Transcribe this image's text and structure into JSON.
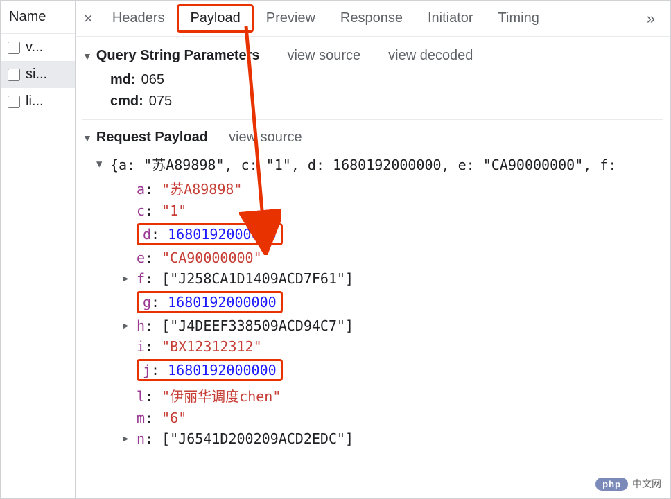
{
  "left": {
    "header": "Name",
    "items": [
      {
        "label": "v...",
        "selected": false
      },
      {
        "label": "si...",
        "selected": true
      },
      {
        "label": "li...",
        "selected": false
      }
    ]
  },
  "tabs": {
    "close_glyph": "×",
    "items": [
      "Headers",
      "Payload",
      "Preview",
      "Response",
      "Initiator",
      "Timing"
    ],
    "highlighted_index": 1,
    "more_glyph": "»"
  },
  "query_section": {
    "title": "Query String Parameters",
    "view_source": "view source",
    "view_decoded": "view decoded",
    "params": [
      {
        "key": "md:",
        "value": "065"
      },
      {
        "key": "cmd:",
        "value": "075"
      }
    ]
  },
  "payload_section": {
    "title": "Request Payload",
    "view_source": "view source",
    "preview_line": "{a: \"苏A89898\", c: \"1\", d: 1680192000000, e: \"CA90000000\", f:",
    "properties": [
      {
        "key": "a",
        "value": "\"苏A89898\"",
        "type": "str",
        "arrow": false,
        "boxed": false
      },
      {
        "key": "c",
        "value": "\"1\"",
        "type": "str",
        "arrow": false,
        "boxed": false
      },
      {
        "key": "d",
        "value": "1680192000000",
        "type": "num",
        "arrow": false,
        "boxed": true
      },
      {
        "key": "e",
        "value": "\"CA90000000\"",
        "type": "str",
        "arrow": false,
        "boxed": false
      },
      {
        "key": "f",
        "value": "[\"J258CA1D1409ACD7F61\"]",
        "type": "punct",
        "arrow": true,
        "boxed": false
      },
      {
        "key": "g",
        "value": "1680192000000",
        "type": "num",
        "arrow": false,
        "boxed": true
      },
      {
        "key": "h",
        "value": "[\"J4DEEF338509ACD94C7\"]",
        "type": "punct",
        "arrow": true,
        "boxed": false
      },
      {
        "key": "i",
        "value": "\"BX12312312\"",
        "type": "str",
        "arrow": false,
        "boxed": false
      },
      {
        "key": "j",
        "value": "1680192000000",
        "type": "num",
        "arrow": false,
        "boxed": true
      },
      {
        "key": "l",
        "value": "\"伊丽华调度chen\"",
        "type": "str",
        "arrow": false,
        "boxed": false
      },
      {
        "key": "m",
        "value": "\"6\"",
        "type": "str",
        "arrow": false,
        "boxed": false
      },
      {
        "key": "n",
        "value": "[\"J6541D200209ACD2EDC\"]",
        "type": "punct",
        "arrow": true,
        "boxed": false
      }
    ]
  },
  "watermark": {
    "badge": "php",
    "text": "中文网"
  }
}
